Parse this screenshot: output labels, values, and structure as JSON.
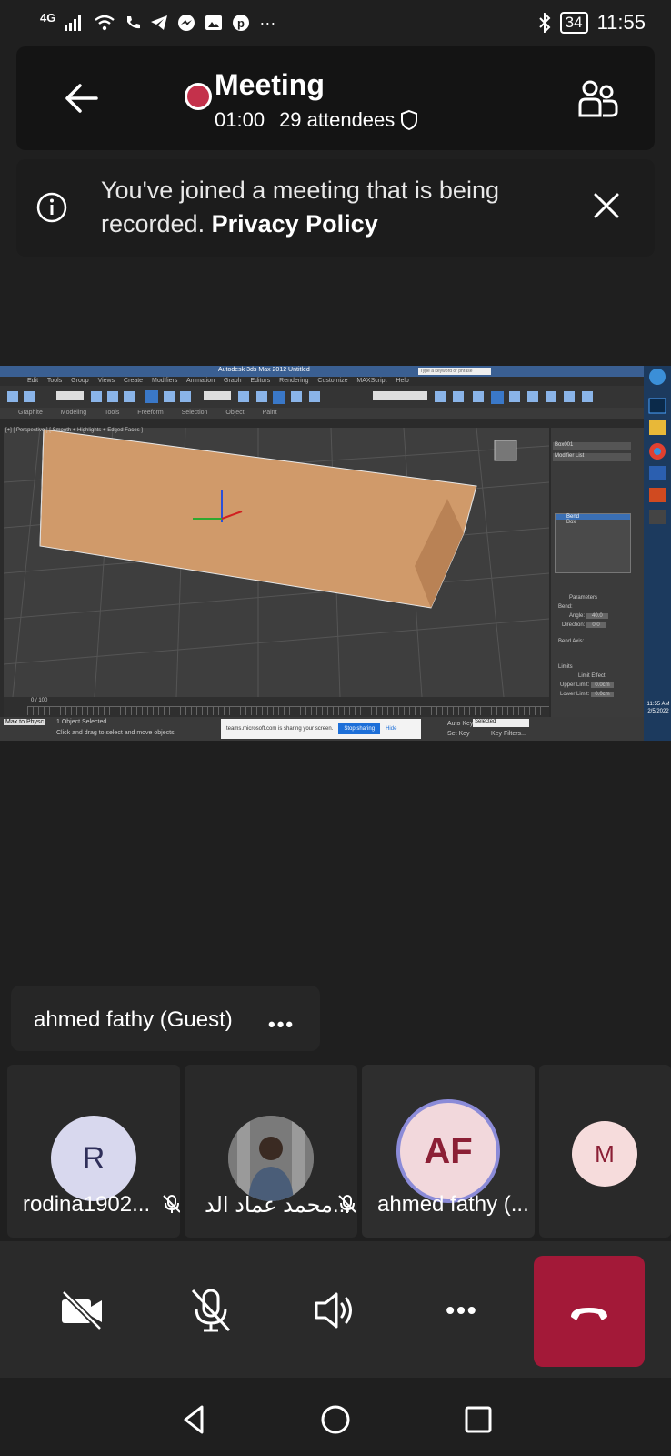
{
  "status_bar": {
    "network": "4G",
    "battery": "34",
    "time": "11:55",
    "more": "···"
  },
  "header": {
    "title": "Meeting",
    "duration": "01:00",
    "attendees": "29 attendees",
    "recording_color": "#c4314b"
  },
  "banner": {
    "text": "You've joined a meeting that is being recorded.",
    "link": "Privacy Policy"
  },
  "shared_screen": {
    "app_title": "Autodesk 3ds Max 2012     Untitled",
    "search_placeholder": "Type a keyword or phrase",
    "menu": "Edit Tools Group Views Create Modifiers Animation Graph Editors Rendering Customize MAXScript Help",
    "ribbon": "Graphite Modeling Tools  Freeform  Selection  Object Paint",
    "status_selection": "1 Object Selected",
    "status_hint": "Click and drag to select and move objects",
    "auto_key": "Auto Key",
    "selected": "Selected",
    "set_key": "Set Key",
    "key_filters": "Key Filters...",
    "share_notice": "teams.microsoft.com is sharing your screen.",
    "stop_sharing": "Stop sharing",
    "hide": "Hide",
    "clock": "11:55 AM",
    "date": "2/5/2022",
    "script_label": "Max to Physc",
    "timeline_label": "0 / 100",
    "modifier_list": "Modifier List",
    "object_name": "Box001",
    "stack_items": [
      "Bend",
      "Box"
    ],
    "params_title": "Parameters",
    "bend_label": "Bend:",
    "angle_label": "Angle:",
    "angle_value": "40.0",
    "direction_label": "Direction:",
    "direction_value": "0.0",
    "bend_axis": "Bend Axis:",
    "limits": "Limits",
    "limit_effect": "Limit Effect",
    "upper_limit": "Upper Limit:",
    "lower_limit": "Lower Limit:",
    "upper_value": "0.0cm",
    "lower_value": "0.0cm",
    "viewport_label": "[+] [ Perspective ] [ Smooth + Highlights + Edged Faces ]"
  },
  "active_speaker": {
    "name": "ahmed fathy (Guest)",
    "more": "•••"
  },
  "participants": [
    {
      "name": "rodina1902...",
      "initials": "R",
      "avatar_bg": "#d8d8ee",
      "avatar_fg": "#2f2f5a"
    },
    {
      "name": "محمد عماد الد...",
      "initials": "",
      "avatar_bg": "#6b6b6b",
      "avatar_fg": "#ffffff"
    },
    {
      "name": "ahmed fathy (...",
      "initials": "AF",
      "avatar_bg": "#f2d8dc",
      "avatar_fg": "#8b1f35"
    },
    {
      "name": "",
      "initials": "M",
      "avatar_bg": "#f6dcdc",
      "avatar_fg": "#8b1f35"
    }
  ],
  "controls": {
    "more": "•••",
    "hangup_color": "#a31938"
  }
}
